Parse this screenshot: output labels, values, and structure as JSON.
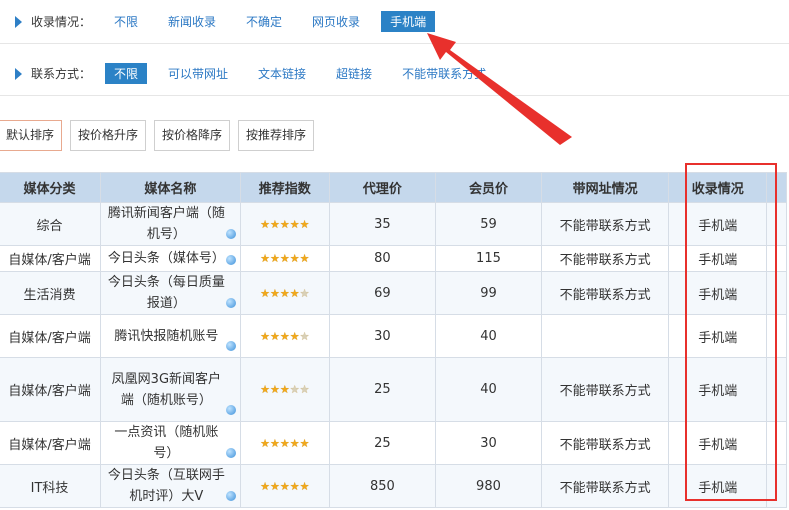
{
  "filters": {
    "inclusion": {
      "label": "收录情况：",
      "options": [
        "不限",
        "新闻收录",
        "不确定",
        "网页收录",
        "手机端"
      ],
      "active_index": 4
    },
    "contact": {
      "label": "联系方式：",
      "options": [
        "不限",
        "可以带网址",
        "文本链接",
        "超链接",
        "不能带联系方式"
      ],
      "active_index": 0
    }
  },
  "sort_buttons": [
    "默认排序",
    "按价格升序",
    "按价格降序",
    "按推荐排序"
  ],
  "table": {
    "headers": [
      "媒体分类",
      "媒体名称",
      "推荐指数",
      "代理价",
      "会员价",
      "带网址情况",
      "收录情况"
    ],
    "rows": [
      {
        "category": "综合",
        "name": "腾讯新闻客户端（随机号）",
        "rating": 5,
        "agent_price": "35",
        "member_price": "59",
        "url": "不能带联系方式",
        "inclusion": "手机端"
      },
      {
        "category": "自媒体/客户端",
        "name": "今日头条（媒体号）",
        "rating": 5,
        "agent_price": "80",
        "member_price": "115",
        "url": "不能带联系方式",
        "inclusion": "手机端"
      },
      {
        "category": "生活消费",
        "name": "今日头条（每日质量报道）",
        "rating": 4,
        "agent_price": "69",
        "member_price": "99",
        "url": "不能带联系方式",
        "inclusion": "手机端"
      },
      {
        "category": "自媒体/客户端",
        "name": "腾讯快报随机账号",
        "rating": 4,
        "agent_price": "30",
        "member_price": "40",
        "url": "",
        "inclusion": "手机端"
      },
      {
        "category": "自媒体/客户端",
        "name": "凤凰网3G新闻客户端（随机账号）",
        "rating": 3,
        "agent_price": "25",
        "member_price": "40",
        "url": "不能带联系方式",
        "inclusion": "手机端"
      },
      {
        "category": "自媒体/客户端",
        "name": "一点资讯（随机账号）",
        "rating": 5,
        "agent_price": "25",
        "member_price": "30",
        "url": "不能带联系方式",
        "inclusion": "手机端"
      },
      {
        "category": "IT科技",
        "name": "今日头条（互联网手机时评）大V",
        "rating": 5,
        "agent_price": "850",
        "member_price": "980",
        "url": "不能带联系方式",
        "inclusion": "手机端"
      }
    ]
  },
  "colors": {
    "accent": "#2b82c6",
    "link": "#2b78c4",
    "header_bg": "#c5d8ec",
    "highlight_red": "#e8302c",
    "star": "#f0a81c"
  }
}
